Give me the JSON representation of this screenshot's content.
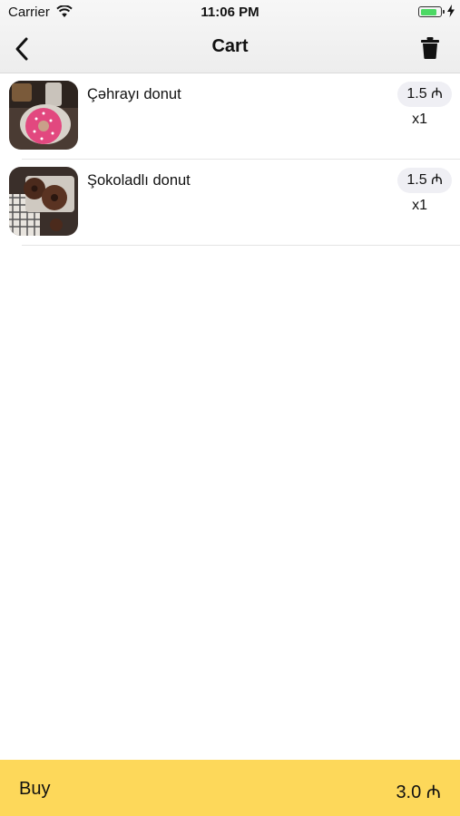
{
  "status": {
    "carrier": "Carrier",
    "time": "11:06 PM",
    "battery_level_percent": 85,
    "battery_color": "#4cd964"
  },
  "nav": {
    "title": "Cart",
    "back_icon": "chevron-left-icon",
    "trash_icon": "trash-icon"
  },
  "items": [
    {
      "name": "Çəhrayı donut",
      "price": "1.5 ₼",
      "quantity": "x1",
      "image": "pink-donut"
    },
    {
      "name": "Şokoladlı donut",
      "price": "1.5 ₼",
      "quantity": "x1",
      "image": "chocolate-donut"
    }
  ],
  "buy": {
    "label": "Buy",
    "total": "3.0 ₼",
    "background": "#fdd85a"
  }
}
